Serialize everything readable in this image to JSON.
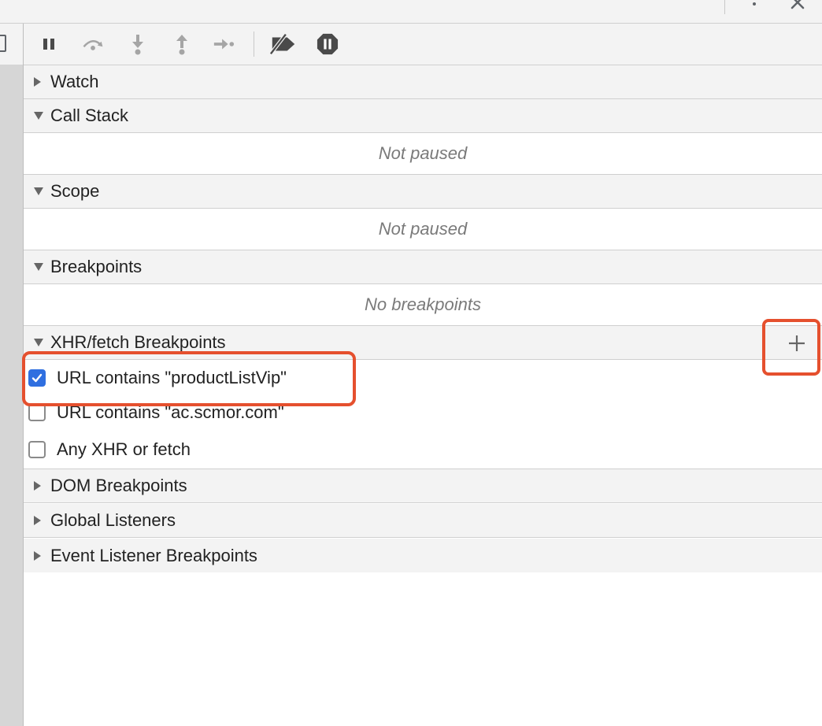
{
  "topbar": {
    "more_icon": "kebab-menu-icon",
    "close_icon": "close-icon"
  },
  "toolbar": {
    "buttons": [
      {
        "name": "pause-button",
        "icon": "pause-icon"
      },
      {
        "name": "step-over-button",
        "icon": "step-over-icon"
      },
      {
        "name": "step-into-button",
        "icon": "step-into-icon"
      },
      {
        "name": "step-out-button",
        "icon": "step-out-icon"
      },
      {
        "name": "step-button",
        "icon": "step-icon"
      },
      {
        "name": "deactivate-breakpoints-button",
        "icon": "deactivate-breakpoints-icon"
      },
      {
        "name": "pause-on-exceptions-button",
        "icon": "pause-on-exceptions-icon"
      }
    ]
  },
  "sections": {
    "watch": {
      "title": "Watch",
      "expanded": false
    },
    "call_stack": {
      "title": "Call Stack",
      "expanded": true,
      "empty_text": "Not paused"
    },
    "scope": {
      "title": "Scope",
      "expanded": true,
      "empty_text": "Not paused"
    },
    "breakpoints": {
      "title": "Breakpoints",
      "expanded": true,
      "empty_text": "No breakpoints"
    },
    "xhr": {
      "title": "XHR/fetch Breakpoints",
      "expanded": true,
      "add_icon": "plus-icon",
      "items": [
        {
          "label": "URL contains \"productListVip\"",
          "checked": true
        },
        {
          "label": "URL contains \"ac.scmor.com\"",
          "checked": false
        },
        {
          "label": "Any XHR or fetch",
          "checked": false
        }
      ]
    },
    "dom": {
      "title": "DOM Breakpoints",
      "expanded": false
    },
    "global": {
      "title": "Global Listeners",
      "expanded": false
    },
    "event": {
      "title": "Event Listener Breakpoints",
      "expanded": false
    }
  },
  "colors": {
    "accent_blue": "#2f6fe0",
    "annotation_red": "#e5502e",
    "panel_gray": "#f3f3f3"
  }
}
